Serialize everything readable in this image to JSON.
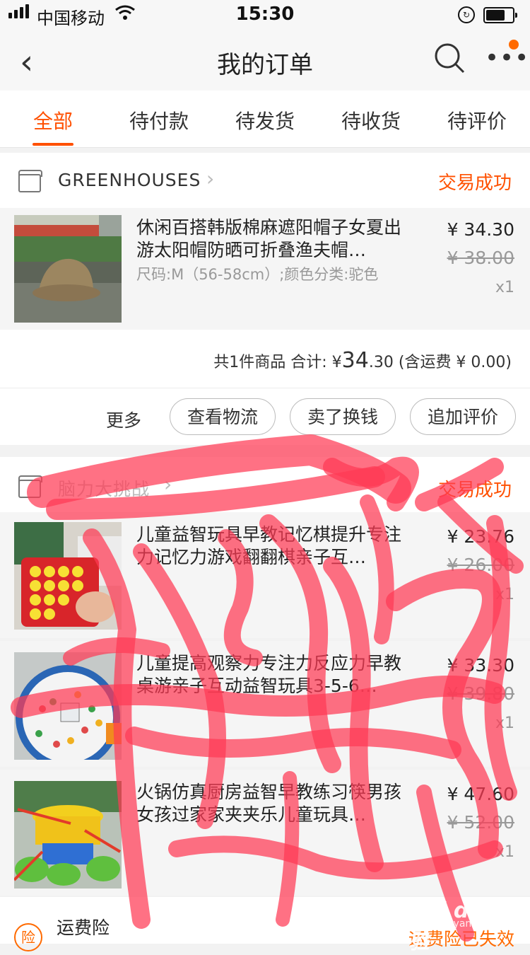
{
  "status_bar": {
    "carrier": "中国移动",
    "time": "15:30"
  },
  "nav": {
    "title": "我的订单",
    "back_icon": "chevron-left-icon",
    "search_icon": "search-icon",
    "more_icon": "more-icon"
  },
  "tabs": [
    {
      "label": "全部",
      "active": true
    },
    {
      "label": "待付款"
    },
    {
      "label": "待发货"
    },
    {
      "label": "待收货"
    },
    {
      "label": "待评价"
    }
  ],
  "orders": [
    {
      "shop": "GREENHOUSES",
      "status": "交易成功",
      "items": [
        {
          "title": "休闲百搭韩版棉麻遮阳帽子女夏出游太阳帽防晒可折叠渔夫帽…",
          "spec": "尺码:M（56-58cm）;颜色分类:驼色",
          "price": "¥ 34.30",
          "original_price": "¥ 38.00",
          "qty": "x1"
        }
      ],
      "summary": {
        "prefix": "共1件商品 合计: ¥",
        "amount_int": "34",
        "amount_dec": ".30",
        "shipping": "(含运费 ¥ 0.00)"
      },
      "actions": {
        "more": "更多",
        "buttons": [
          "查看物流",
          "卖了换钱",
          "追加评价"
        ]
      }
    },
    {
      "shop": "脑力大挑战",
      "status": "交易成功",
      "items": [
        {
          "title": "儿童益智玩具早教记忆棋提升专注力记忆力游戏翻翻棋亲子互…",
          "price": "¥ 23.76",
          "original_price": "¥ 26.00",
          "qty": "x1"
        },
        {
          "title": "儿童提高观察力专注力反应力早教桌游亲子互动益智玩具3-5-6…",
          "price": "¥ 33.30",
          "original_price": "¥ 39.80",
          "qty": "x1"
        },
        {
          "title": "火锅仿真厨房益智早教练习筷男孩女孩过家家夹夹乐儿童玩具…",
          "price": "¥ 47.60",
          "original_price": "¥ 52.00",
          "qty": "x1"
        }
      ],
      "insurance": {
        "icon_text": "险",
        "label": "运费险",
        "status": "运费险已失效"
      }
    }
  ],
  "watermark": {
    "text": "Bai du 经验",
    "sub": "jingyan.baidu.com"
  },
  "colors": {
    "accent": "#ff5000",
    "scribble": "#ff3a55"
  }
}
